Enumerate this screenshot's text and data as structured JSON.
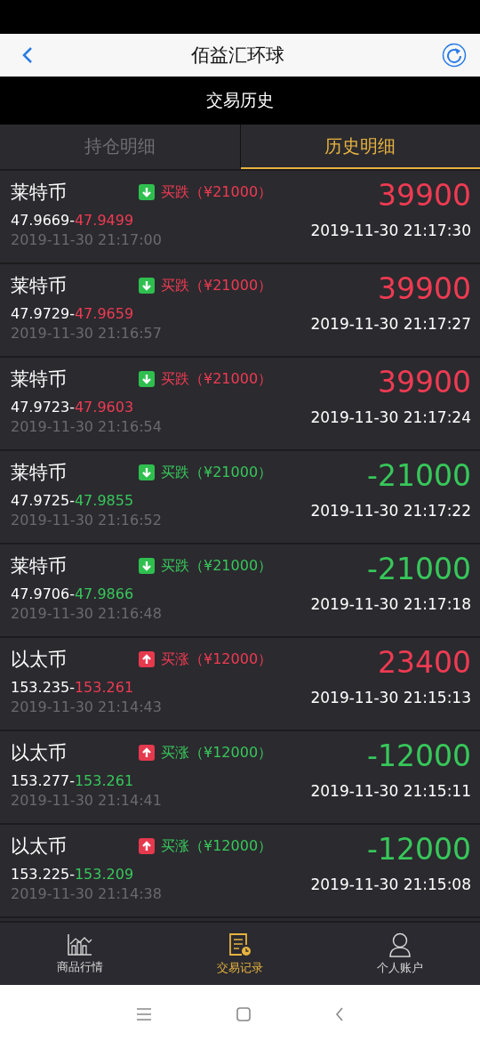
{
  "header": {
    "title": "佰益汇环球",
    "subtitle": "交易历史"
  },
  "tabs": [
    {
      "label": "持仓明细",
      "selected": false
    },
    {
      "label": "历史明细",
      "selected": true
    }
  ],
  "trades": [
    {
      "name": "莱特币",
      "kind": "down",
      "order": "买跌（¥21000）",
      "color": "#ef3b52",
      "open_price": "47.9669-",
      "close_price": "47.9499",
      "open_time": "2019-11-30 21:17:00",
      "profit": "39900",
      "close_time": "2019-11-30 21:17:30"
    },
    {
      "name": "莱特币",
      "kind": "down",
      "order": "买跌（¥21000）",
      "color": "#ef3b52",
      "open_price": "47.9729-",
      "close_price": "47.9659",
      "open_time": "2019-11-30 21:16:57",
      "profit": "39900",
      "close_time": "2019-11-30 21:17:27"
    },
    {
      "name": "莱特币",
      "kind": "down",
      "order": "买跌（¥21000）",
      "color": "#ef3b52",
      "open_price": "47.9723-",
      "close_price": "47.9603",
      "open_time": "2019-11-30 21:16:54",
      "profit": "39900",
      "close_time": "2019-11-30 21:17:24"
    },
    {
      "name": "莱特币",
      "kind": "down",
      "order": "买跌（¥21000）",
      "color": "#37c85a",
      "open_price": "47.9725-",
      "close_price": "47.9855",
      "open_time": "2019-11-30 21:16:52",
      "profit": "-21000",
      "close_time": "2019-11-30 21:17:22"
    },
    {
      "name": "莱特币",
      "kind": "down",
      "order": "买跌（¥21000）",
      "color": "#37c85a",
      "open_price": "47.9706-",
      "close_price": "47.9866",
      "open_time": "2019-11-30 21:16:48",
      "profit": "-21000",
      "close_time": "2019-11-30 21:17:18"
    },
    {
      "name": "以太币",
      "kind": "up",
      "order": "买涨（¥12000）",
      "color": "#ef3b52",
      "open_price": "153.235-",
      "close_price": "153.261",
      "open_time": "2019-11-30 21:14:43",
      "profit": "23400",
      "close_time": "2019-11-30 21:15:13"
    },
    {
      "name": "以太币",
      "kind": "up",
      "order": "买涨（¥12000）",
      "color": "#37c85a",
      "open_price": "153.277-",
      "close_price": "153.261",
      "open_time": "2019-11-30 21:14:41",
      "profit": "-12000",
      "close_time": "2019-11-30 21:15:11"
    },
    {
      "name": "以太币",
      "kind": "up",
      "order": "买涨（¥12000）",
      "color": "#37c85a",
      "open_price": "153.225-",
      "close_price": "153.209",
      "open_time": "2019-11-30 21:14:38",
      "profit": "-12000",
      "close_time": "2019-11-30 21:15:08"
    }
  ],
  "bottom_nav": [
    {
      "label": "商品行情",
      "selected": false
    },
    {
      "label": "交易记录",
      "selected": true
    },
    {
      "label": "个人账户",
      "selected": false
    }
  ]
}
